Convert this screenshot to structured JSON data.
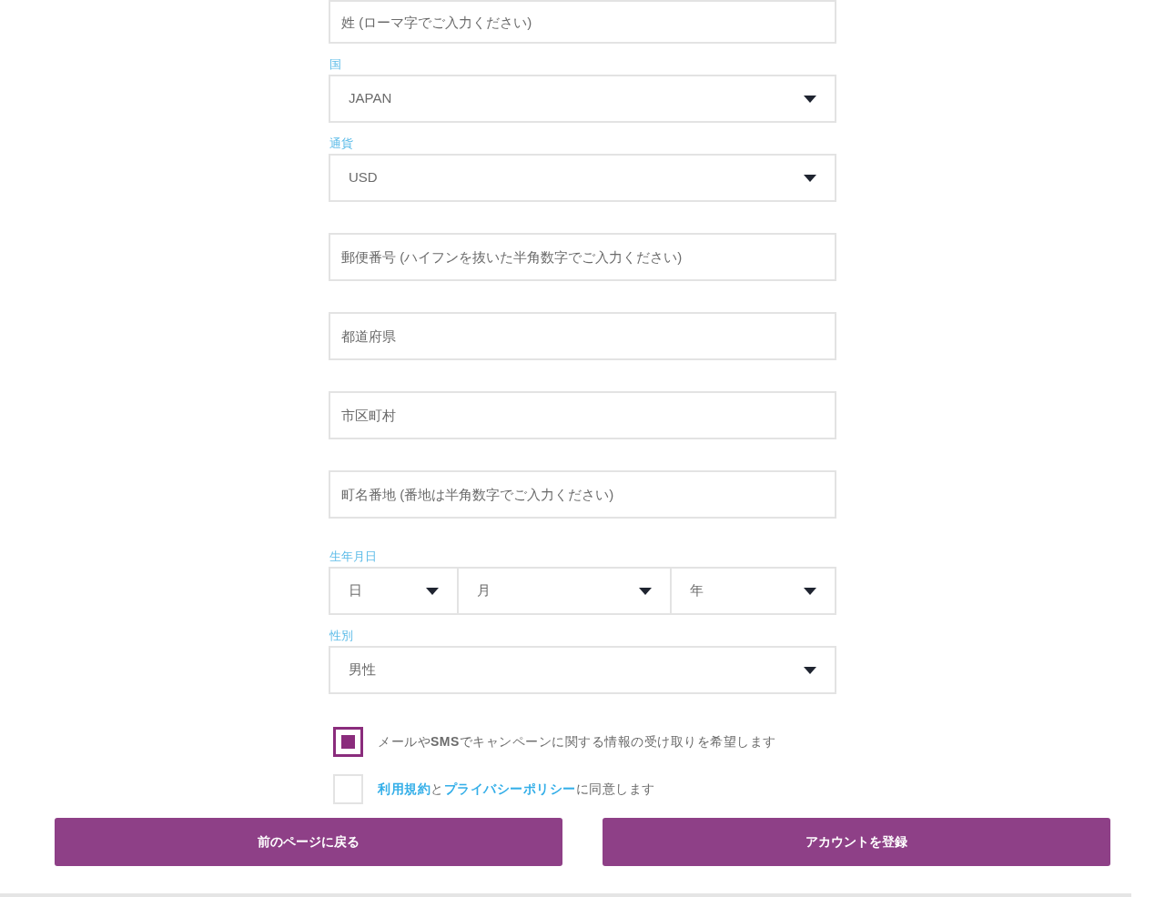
{
  "fields": [
    {
      "kind": "input",
      "placeholder": "姓 (ローマ字でご入力ください)"
    },
    {
      "kind": "select",
      "label": "国",
      "value": "JAPAN"
    },
    {
      "kind": "select",
      "label": "通貨",
      "value": "USD"
    },
    {
      "kind": "input",
      "placeholder": "郵便番号 (ハイフンを抜いた半角数字でご入力ください)"
    },
    {
      "kind": "input",
      "placeholder": "都道府県"
    },
    {
      "kind": "input",
      "placeholder": "市区町村"
    },
    {
      "kind": "input",
      "placeholder": "町名番地 (番地は半角数字でご入力ください)"
    },
    {
      "kind": "date",
      "label": "生年月日",
      "parts": [
        "日",
        "月",
        "年"
      ]
    },
    {
      "kind": "select",
      "label": "性別",
      "value": "男性"
    }
  ],
  "checkboxes": [
    {
      "checked": true,
      "parts": [
        {
          "text": "メールや**SMS**でキャンペーンに関する情報の受け取りを希望します",
          "kind": "text"
        }
      ]
    },
    {
      "checked": false,
      "parts": [
        {
          "text": "利用規約",
          "kind": "link"
        },
        {
          "text": "と",
          "kind": "text"
        },
        {
          "text": "プライバシーポリシー",
          "kind": "link"
        },
        {
          "text": "に同意します",
          "kind": "text"
        }
      ]
    }
  ],
  "buttons": [
    "前のページに戻る",
    "アカウントを登録"
  ]
}
